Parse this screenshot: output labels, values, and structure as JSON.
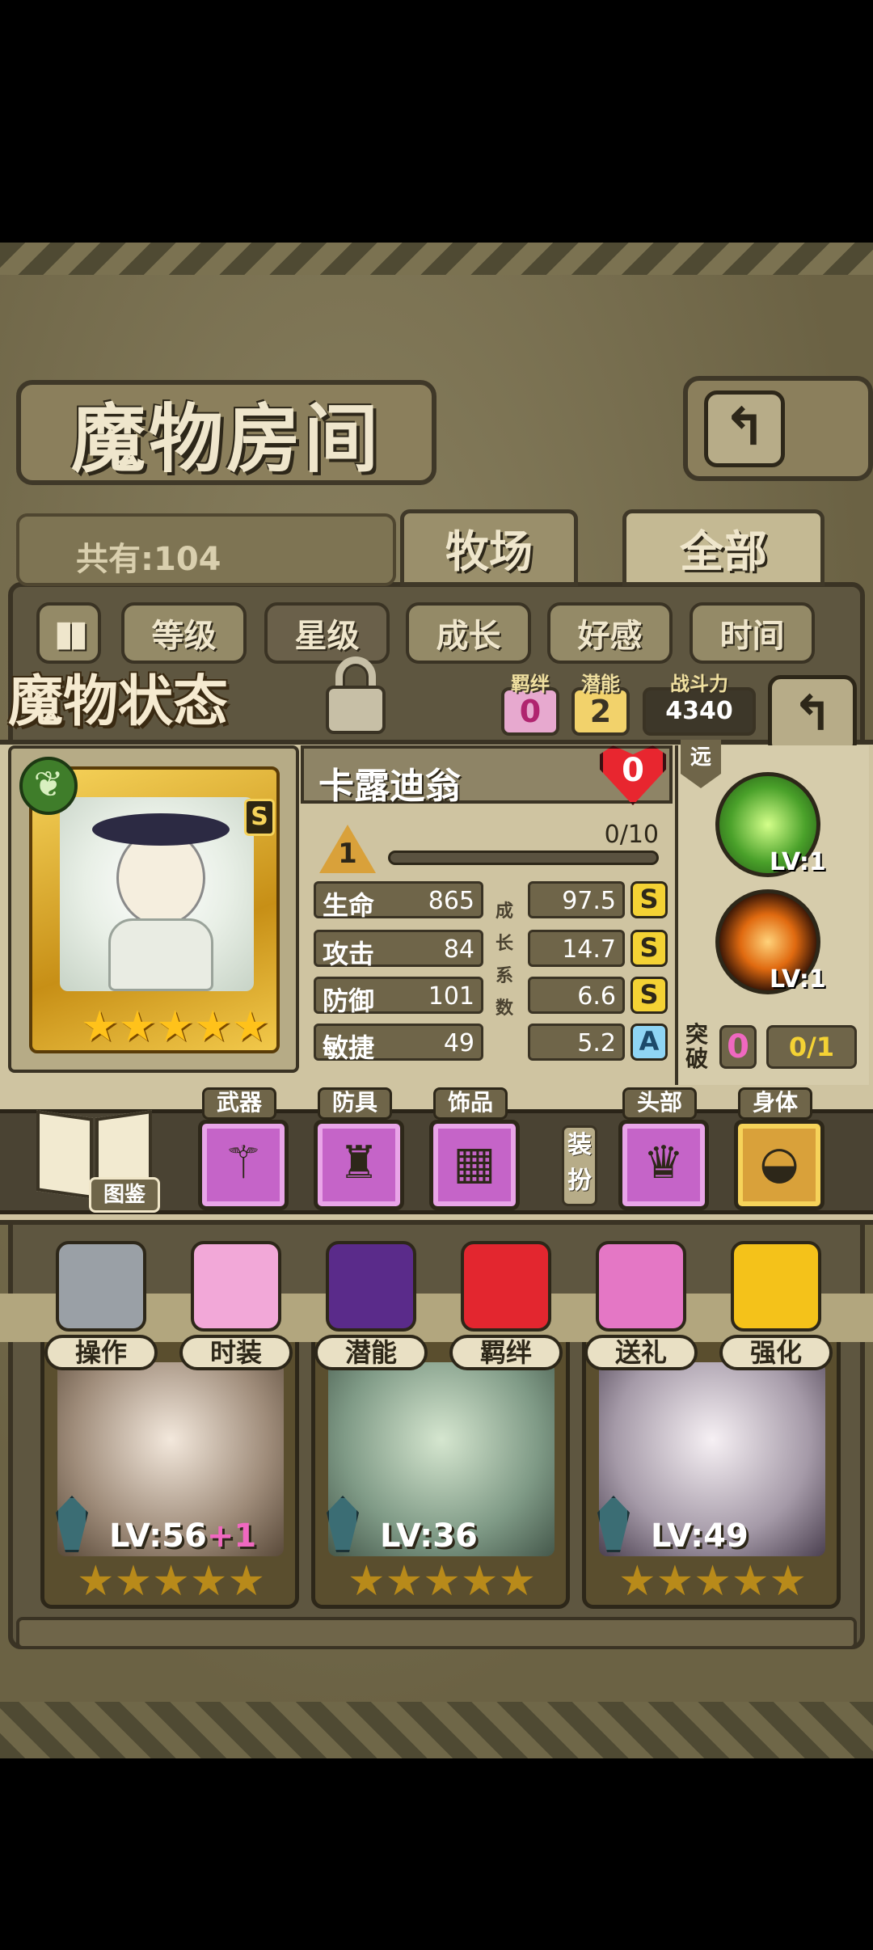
{
  "header": {
    "title": "魔物房间",
    "back_icon": "↰",
    "count_label": "共有:104",
    "tabs": [
      {
        "label": "牧场"
      },
      {
        "label": "全部"
      }
    ]
  },
  "sort": {
    "buttons": [
      {
        "label": "等级"
      },
      {
        "label": "星级"
      },
      {
        "label": "成长"
      },
      {
        "label": "好感"
      },
      {
        "label": "时间"
      }
    ]
  },
  "status": {
    "title": "魔物状态",
    "bond_label": "羁绊",
    "bond_value": "0",
    "potential_label": "潜能",
    "potential_value": "2",
    "power_label": "战斗力",
    "power_value": "4340",
    "monster_name": "卡露迪翁",
    "rank": "S",
    "affection": "0",
    "level": "1",
    "exp": "0/10",
    "exp_fraction": 0,
    "growth_label": "成长系数",
    "stats": [
      {
        "name": "生命",
        "value": "865",
        "growth": "97.5",
        "grade": "S"
      },
      {
        "name": "攻击",
        "value": "84",
        "growth": "14.7",
        "grade": "S"
      },
      {
        "name": "防御",
        "value": "101",
        "growth": "6.6",
        "grade": "S"
      },
      {
        "name": "敏捷",
        "value": "49",
        "growth": "5.2",
        "grade": "A"
      }
    ],
    "range_tag": "远",
    "skills": [
      {
        "level": "LV:1"
      },
      {
        "level": "LV:1"
      }
    ],
    "break_label": "突破",
    "break_value": "0",
    "break_progress": "0/1",
    "stars": 5
  },
  "equipment": {
    "book_label": "图鉴",
    "dress_label": "装扮",
    "slots": [
      {
        "tag": "武器"
      },
      {
        "tag": "防具"
      },
      {
        "tag": "饰品"
      },
      {
        "tag": "头部"
      },
      {
        "tag": "身体"
      }
    ]
  },
  "actions": [
    {
      "label": "操作"
    },
    {
      "label": "时装"
    },
    {
      "label": "潜能"
    },
    {
      "label": "羁绊"
    },
    {
      "label": "送礼"
    },
    {
      "label": "强化"
    }
  ],
  "cards": [
    {
      "level": "LV:56",
      "plus": "+1",
      "stars": 5
    },
    {
      "level": "LV:36",
      "plus": "",
      "stars": 5
    },
    {
      "level": "LV:49",
      "plus": "",
      "stars": 5
    }
  ]
}
